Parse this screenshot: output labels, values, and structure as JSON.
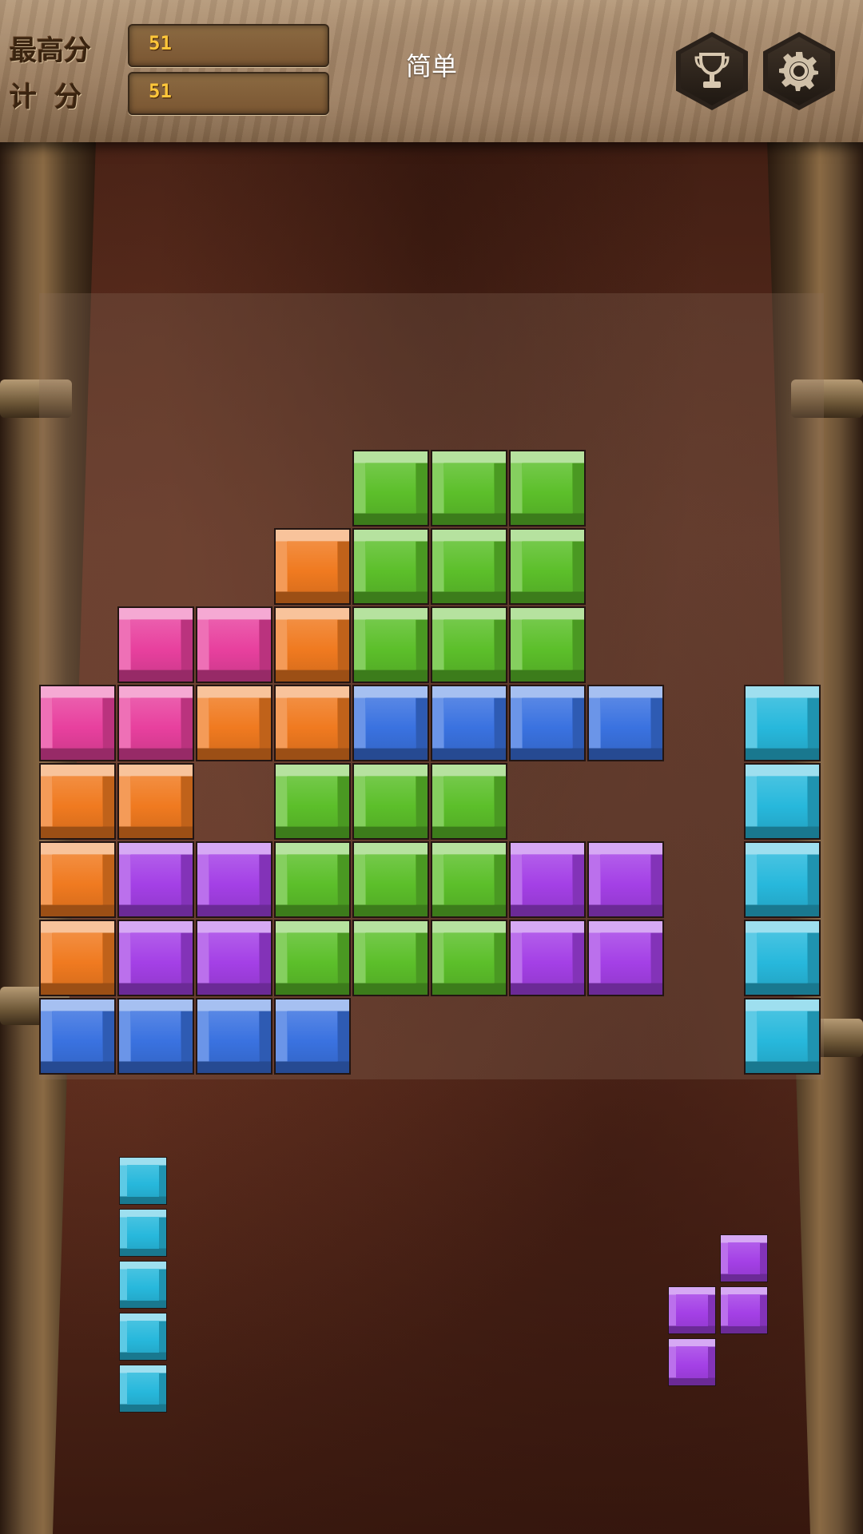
{
  "header": {
    "best_label": "最高分",
    "score_label": "计分",
    "best_value": "51",
    "score_value": "51",
    "difficulty": "简单",
    "trophy_icon": "trophy-icon",
    "settings_icon": "gear-icon"
  },
  "colors": {
    "green": "#5cbf2a",
    "orange": "#f07a20",
    "pink": "#e8409e",
    "blue": "#3a72e0",
    "purple": "#a440e6",
    "cyan": "#27b8dc"
  },
  "board": {
    "columns": 10,
    "rows": 8,
    "cells": [
      [
        null,
        null,
        null,
        null,
        "green",
        "green",
        "green",
        null,
        null,
        null
      ],
      [
        null,
        null,
        null,
        "orange",
        "green",
        "green",
        "green",
        null,
        null,
        null
      ],
      [
        null,
        "pink",
        "pink",
        "orange",
        "green",
        "green",
        "green",
        null,
        null,
        null
      ],
      [
        "pink",
        "pink",
        "orange",
        "orange",
        "blue",
        "blue",
        "blue",
        "blue",
        null,
        "cyan"
      ],
      [
        "orange",
        "orange",
        null,
        "green",
        "green",
        "green",
        null,
        null,
        null,
        "cyan"
      ],
      [
        "orange",
        "purple",
        "purple",
        "green",
        "green",
        "green",
        "purple",
        "purple",
        null,
        "cyan"
      ],
      [
        "orange",
        "purple",
        "purple",
        "green",
        "green",
        "green",
        "purple",
        "purple",
        null,
        "cyan"
      ],
      [
        "blue",
        "blue",
        "blue",
        "blue",
        null,
        null,
        null,
        null,
        null,
        "cyan"
      ]
    ]
  },
  "pieces": [
    {
      "name": "piece-left-cyan-i",
      "color": "cyan",
      "shape": [
        [
          1
        ],
        [
          1
        ],
        [
          1
        ],
        [
          1
        ],
        [
          1
        ]
      ]
    },
    {
      "name": "piece-right-purple-s",
      "color": "purple",
      "shape": [
        [
          0,
          1
        ],
        [
          1,
          1
        ],
        [
          1,
          0
        ]
      ]
    }
  ]
}
